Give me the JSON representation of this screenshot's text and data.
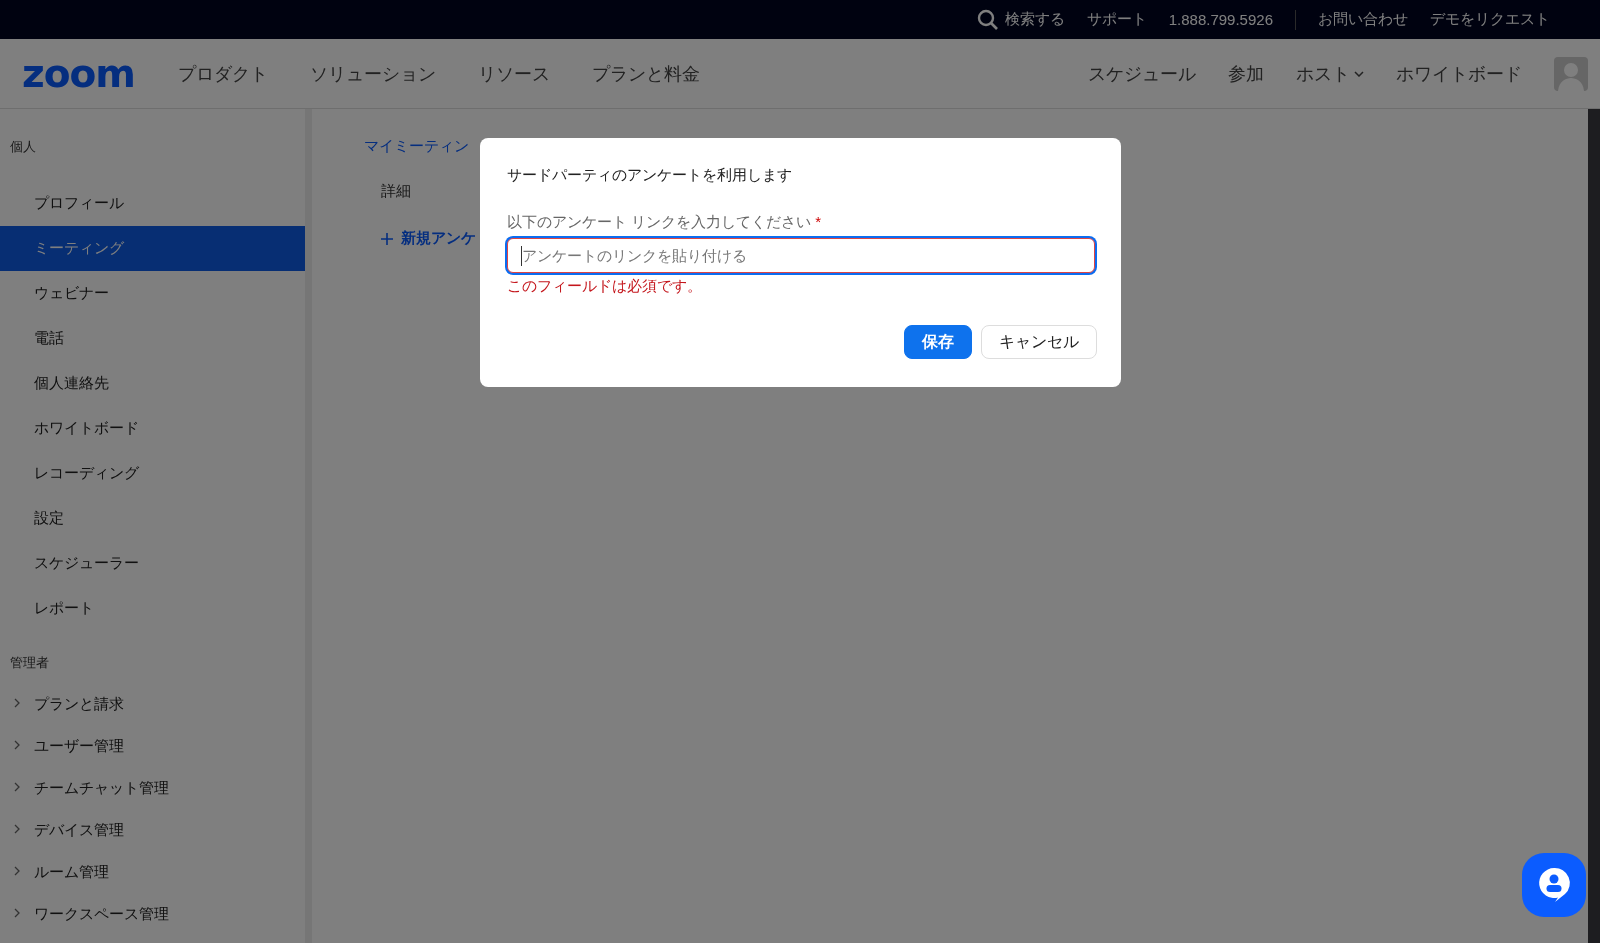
{
  "top_bar": {
    "search": "検索する",
    "links": [
      "サポート",
      "1.888.799.5926"
    ],
    "links_after_divider": [
      "お問い合わせ",
      "デモをリクエスト"
    ]
  },
  "nav": {
    "logo": "zoom",
    "menu": [
      "プロダクト",
      "ソリューション",
      "リソース",
      "プランと料金"
    ],
    "right": [
      {
        "label": "スケジュール",
        "dropdown": false
      },
      {
        "label": "参加",
        "dropdown": false
      },
      {
        "label": "ホスト",
        "dropdown": true
      },
      {
        "label": "ホワイトボード",
        "dropdown": false
      }
    ]
  },
  "sidebar": {
    "sections": [
      {
        "title": "個人",
        "items": [
          {
            "label": "プロフィール",
            "selected": false,
            "expandable": false
          },
          {
            "label": "ミーティング",
            "selected": true,
            "expandable": false
          },
          {
            "label": "ウェビナー",
            "selected": false,
            "expandable": false
          },
          {
            "label": "電話",
            "selected": false,
            "expandable": false
          },
          {
            "label": "個人連絡先",
            "selected": false,
            "expandable": false
          },
          {
            "label": "ホワイトボード",
            "selected": false,
            "expandable": false
          },
          {
            "label": "レコーディング",
            "selected": false,
            "expandable": false
          },
          {
            "label": "設定",
            "selected": false,
            "expandable": false
          },
          {
            "label": "スケジューラー",
            "selected": false,
            "expandable": false
          },
          {
            "label": "レポート",
            "selected": false,
            "expandable": false
          }
        ]
      },
      {
        "title": "管理者",
        "items": [
          {
            "label": "プランと請求",
            "selected": false,
            "expandable": true
          },
          {
            "label": "ユーザー管理",
            "selected": false,
            "expandable": true
          },
          {
            "label": "チームチャット管理",
            "selected": false,
            "expandable": true
          },
          {
            "label": "デバイス管理",
            "selected": false,
            "expandable": true
          },
          {
            "label": "ルーム管理",
            "selected": false,
            "expandable": true
          },
          {
            "label": "ワークスペース管理",
            "selected": false,
            "expandable": true
          }
        ]
      }
    ]
  },
  "content": {
    "breadcrumb": "マイミーティン",
    "tab": "詳細",
    "new_button": "新規アンケ"
  },
  "dialog": {
    "title": "サードパーティのアンケートを利用します",
    "field": {
      "label": "以下のアンケート リンクを入力してください",
      "required_mark": "*",
      "placeholder": "アンケートのリンクを貼り付ける",
      "error": "このフィールドは必須です。"
    },
    "buttons": [
      {
        "label": "保存",
        "kind": "primary"
      },
      {
        "label": "キャンセル",
        "kind": "secondary"
      }
    ]
  }
}
